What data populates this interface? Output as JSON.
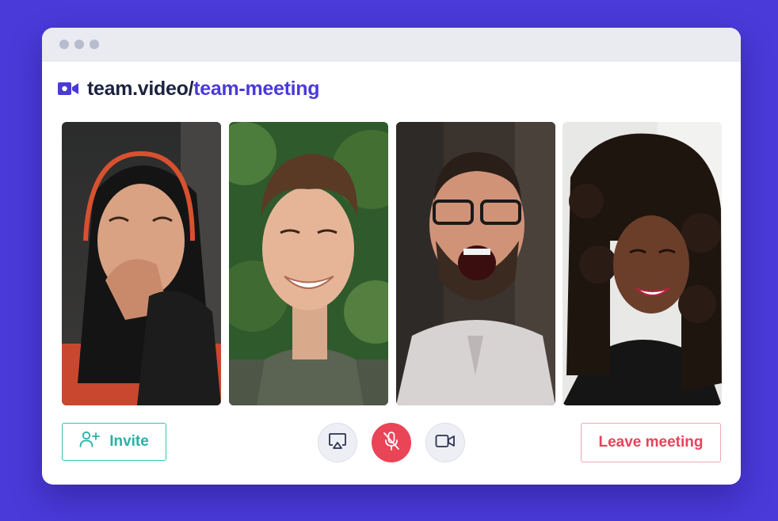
{
  "colors": {
    "background": "#4a3ad9",
    "accent": "#4a3ad9",
    "invite": "#26b3a5",
    "danger": "#e5445a",
    "mute_bg": "#ea4457"
  },
  "window": {
    "title_dots": [
      "dot",
      "dot",
      "dot"
    ]
  },
  "address": {
    "icon": "video-camera-icon",
    "host": "team.video",
    "separator": "/",
    "room": "team-meeting"
  },
  "participants": [
    {
      "id": "participant-1",
      "description": "woman in black hijab covering mouth while laughing"
    },
    {
      "id": "participant-2",
      "description": "young man with curly brown hair smiling"
    },
    {
      "id": "participant-3",
      "description": "bearded man with glasses shouting excitedly"
    },
    {
      "id": "participant-4",
      "description": "woman with curly hair smiling"
    }
  ],
  "controls": {
    "invite_label": "Invite",
    "invite_icon": "add-user-icon",
    "screen_share_icon": "airplay-icon",
    "mute_icon": "microphone-off-icon",
    "camera_icon": "video-camera-icon",
    "leave_label": "Leave meeting"
  }
}
